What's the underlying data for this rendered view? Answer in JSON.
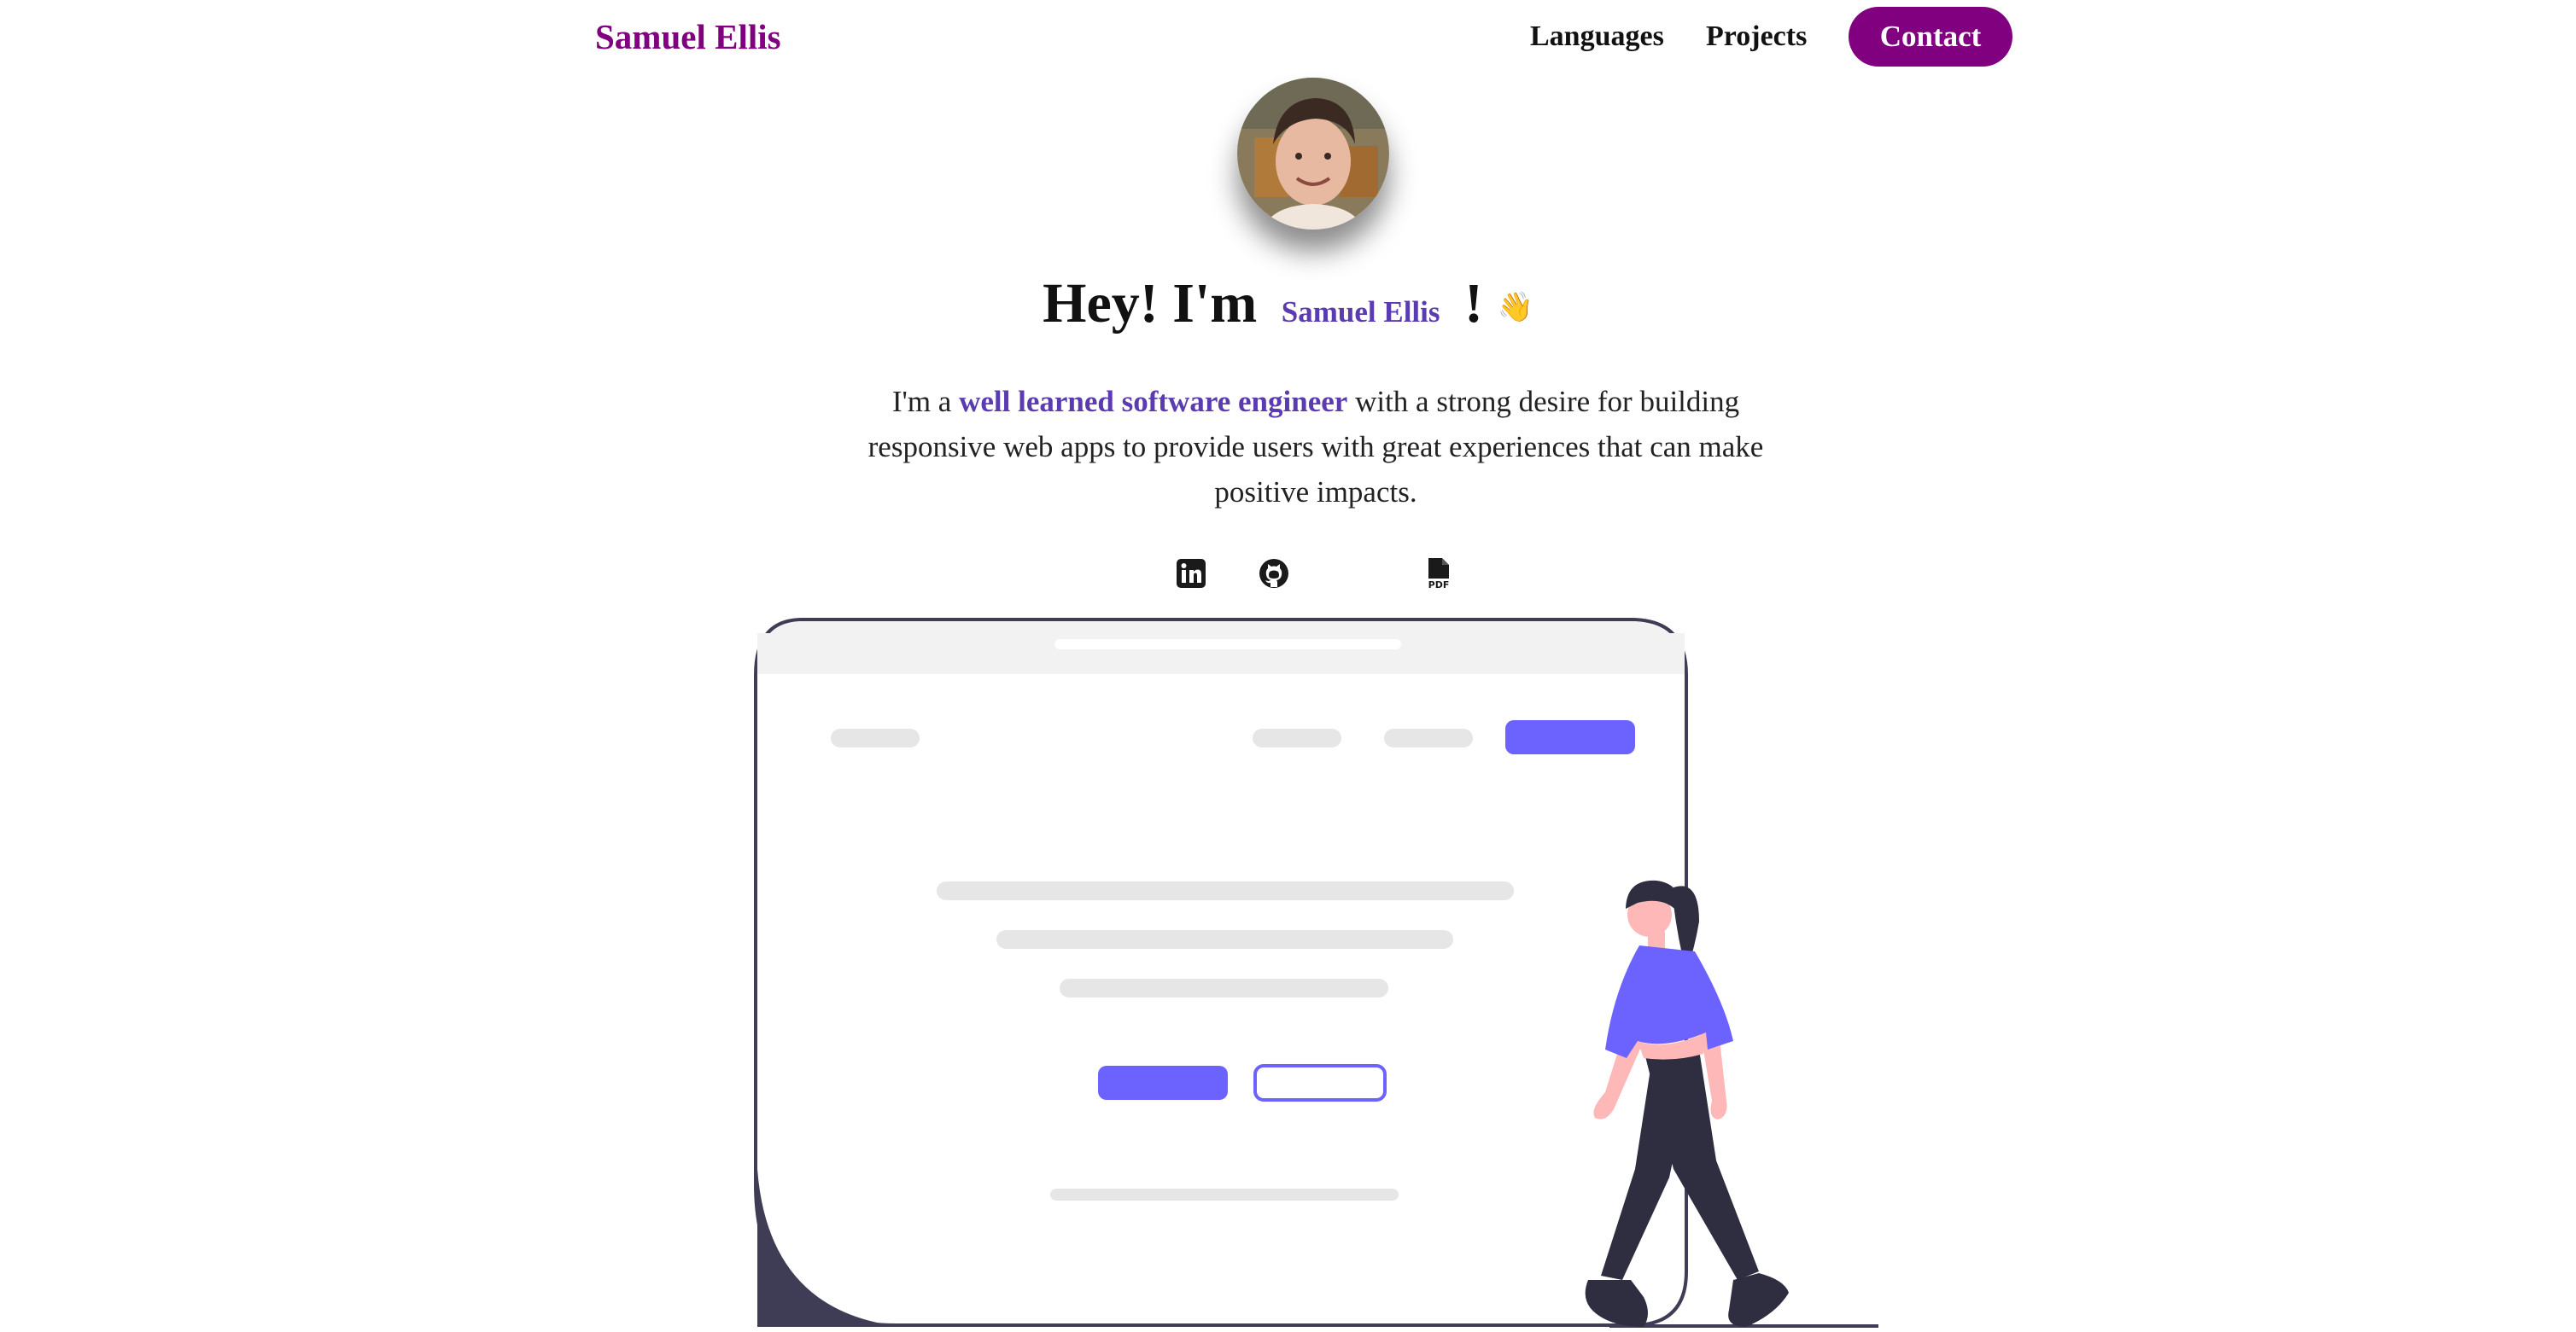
{
  "nav": {
    "brand": "Samuel Ellis",
    "links": [
      "Languages",
      "Projects"
    ],
    "contact": "Contact"
  },
  "hero": {
    "greeting": "Hey! I'm",
    "name": "Samuel Ellis",
    "exclaim": "!",
    "wave": "👋",
    "intro_before": "I'm a",
    "intro_highlight": "well learned software engineer",
    "intro_after": "with a strong desire for building responsive web apps to provide users with great experiences that can make positive impacts."
  },
  "social": {
    "icons": [
      "linkedin-icon",
      "github-icon",
      "pdf-icon"
    ]
  },
  "colors": {
    "brand": "#800080",
    "highlight": "#5b3bb0",
    "illustration_accent": "#6c63ff",
    "illustration_dark": "#3f3d56"
  }
}
